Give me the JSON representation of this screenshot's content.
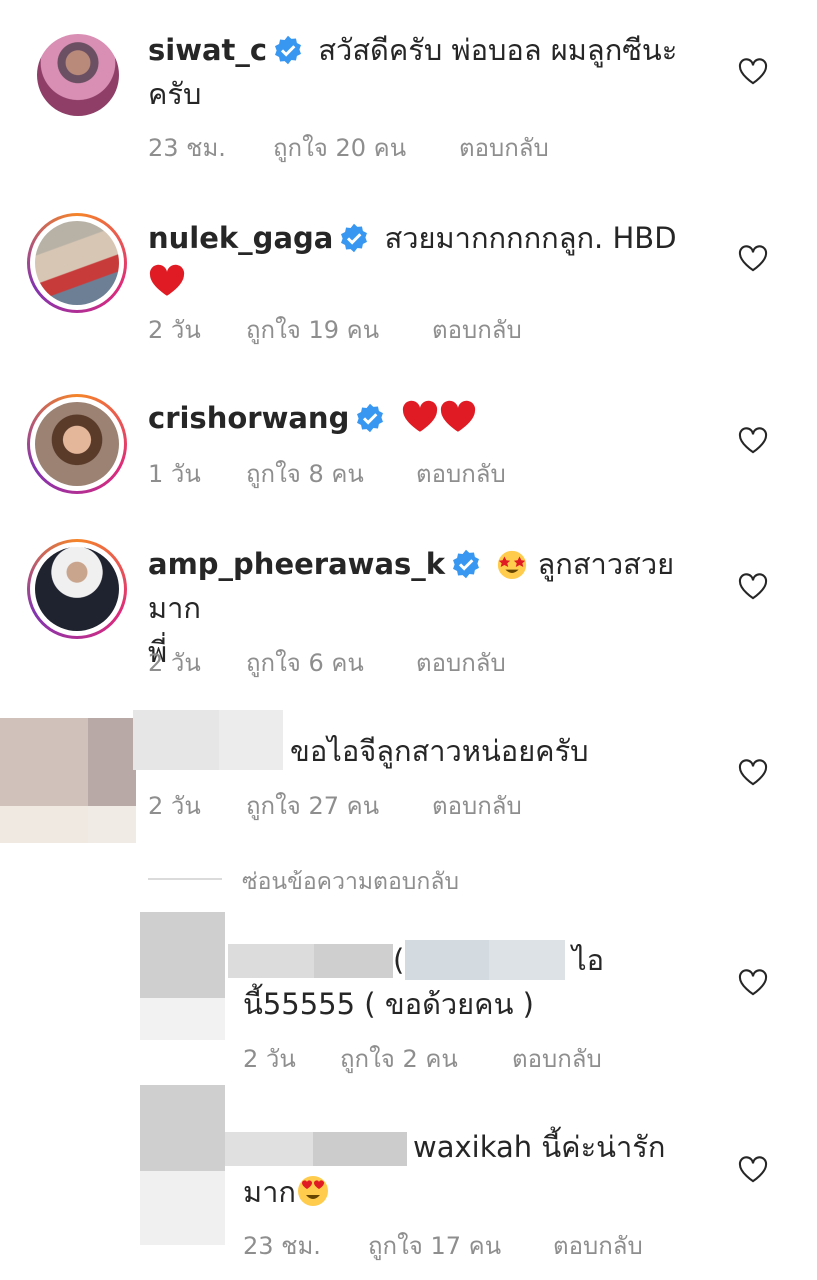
{
  "comments": [
    {
      "username": "siwat_c",
      "text": "สวัสดีครับ พ่อบอล ผมลูกซีนะครับ",
      "text_line1": "สวัสดีครับ พ่อบอล ผมลูกซีนะ",
      "text_line2": "ครับ",
      "time": "23 ชม.",
      "likes": "ถูกใจ 20 คน",
      "reply": "ตอบกลับ"
    },
    {
      "username": "nulek_gaga",
      "text": "สวยมากกกกกลูก. HBD",
      "time": "2 วัน",
      "likes": "ถูกใจ 19 คน",
      "reply": "ตอบกลับ"
    },
    {
      "username": "crishorwang",
      "time": "1 วัน",
      "likes": "ถูกใจ 8 คน",
      "reply": "ตอบกลับ"
    },
    {
      "username": "amp_pheerawas_k",
      "text_line1": "ลูกสาวสวยมาก",
      "text_line2": "พี่",
      "time": "2 วัน",
      "likes": "ถูกใจ 6 คน",
      "reply": "ตอบกลับ"
    },
    {
      "text": "ขอไอจีลูกสาวหน่อยครับ",
      "time": "2 วัน",
      "likes": "ถูกใจ 27 คน",
      "reply": "ตอบกลับ"
    }
  ],
  "hide_replies": "ซ่อนข้อความตอบกลับ",
  "replies": [
    {
      "text_line1_mark": "(",
      "text_line1_tail": "ไอ",
      "text_line2": "นี้55555 ( ขอด้วยคน )",
      "time": "2 วัน",
      "likes": "ถูกใจ 2 คน",
      "reply": "ตอบกลับ"
    },
    {
      "text_line1": "waxikah นี้ค่ะน่ารัก",
      "text_line2": "มาก",
      "time": "23 ชม.",
      "likes": "ถูกใจ 17 คน",
      "reply": "ตอบกลับ"
    }
  ],
  "colors": {
    "verified": "#3897f0",
    "heart": "#ed4956",
    "meta": "#8e8e8e"
  }
}
